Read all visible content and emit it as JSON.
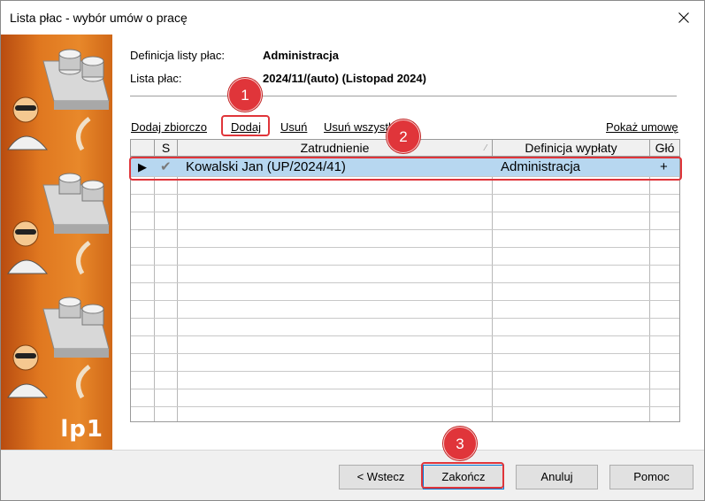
{
  "window": {
    "title": "Lista płac - wybór umów o pracę"
  },
  "sidebar": {
    "label": "lp1"
  },
  "info": {
    "definition_label": "Definicja listy płac:",
    "definition_value": "Administracja",
    "payroll_label": "Lista płac:",
    "payroll_value": "2024/11/(auto) (Listopad 2024)"
  },
  "toolbar": {
    "add_bulk": "Dodaj zbiorczo",
    "add": "Dodaj",
    "remove": "Usuń",
    "remove_all": "Usuń wszystkie",
    "show_contract": "Pokaż umowę"
  },
  "grid": {
    "columns": [
      "",
      "S",
      "Zatrudnienie",
      "Definicja wypłaty",
      "Głó"
    ],
    "rows": [
      {
        "indicator": "▶",
        "status": "✔",
        "employment": "Kowalski Jan (UP/2024/41)",
        "definition": "Administracja",
        "main": "+"
      }
    ]
  },
  "badges": [
    "1",
    "2",
    "3"
  ],
  "buttons": {
    "back": "< Wstecz",
    "finish": "Zakończ",
    "cancel": "Anuluj",
    "help": "Pomoc"
  },
  "colors": {
    "accent": "#e0353a",
    "selection": "#b7d7f0",
    "sidebar": "#e07820"
  }
}
